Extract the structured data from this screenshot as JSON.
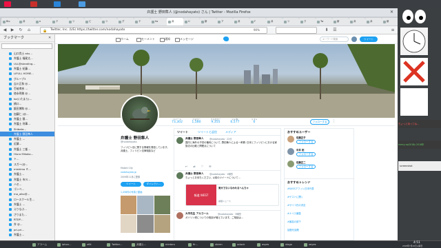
{
  "window_title": "弁護士 野田隼人 (@nodahayato) さん | Twitter - Mozilla Firefox",
  "tabs": [
    "Blo",
    "弁",
    "e",
    "テ",
    "ツ",
    "ビ",
    "ツ",
    "グ",
    "テ",
    "tw",
    "弁",
    "U",
    "新",
    "ア",
    "弁",
    "F",
    "弁",
    "ツ",
    "ク",
    "Tw",
    "新",
    "弁",
    "弁",
    "新"
  ],
  "url": "Twitter, Inc. (US)  https://twitter.com/nodahayato",
  "zoom": "90%",
  "sidebar": {
    "title": "ブックマーク",
    "items": [
      "山口貴士 aku…",
      "弁護士 福尾太…",
      "ULL@standing…",
      "弁護士 紀藤…",
      "LIFULL HOME…",
      "グループ3",
      "吉川正和 @…",
      "壱岐孝彦 …",
      "徳永明美 @…",
      "ka(いたまら)…",
      "橋口…",
      "飯田博和 @…",
      "加藤仁 (@…",
      "弁護士 猿…",
      "弁護士 刑事…",
      "Shibata…",
      "弁護士 野田隼人",
      "弁護士 …",
      "近藤…",
      "弁護士 三峯…",
      "Hiura Mikako…",
      "ト…",
      "スガー(@…",
      "mishima ミ…",
      "弁護士…",
      "弁護士 市川…",
      "ハセ…",
      "ゴンベ…",
      "mo_aiko@…",
      "ロースクール生…",
      "弁護士 …",
      "えりなぷ…",
      "さりまた…",
      "RTDP…",
      "弁 @…",
      "pri-pri…",
      "弁護士…"
    ],
    "selected_index": 16
  },
  "twitter": {
    "nav": [
      "ホーム",
      "モーメント",
      "通知",
      "メッセージ"
    ],
    "search_placeholder": "キーワード検索",
    "tweet_button": "ツイート",
    "stats": [
      {
        "label": "ツイート",
        "value": "73,302"
      },
      {
        "label": "フォロー",
        "value": "1,580"
      },
      {
        "label": "フォロワー",
        "value": "9,355"
      },
      {
        "label": "いいね",
        "value": "6,577"
      },
      {
        "label": "リスト",
        "value": "6"
      }
    ],
    "follow_button": "フォローする",
    "profile": {
      "name": "弁護士 野田隼人",
      "handle": "@nodahayato",
      "bio": "フィリピン法に関する情報を発信しています。弁護士、フィリピン法律相談など",
      "location": "Makati City",
      "website": "nodahayato.jp",
      "joined": "2009年11月に登録",
      "btn_tweet": "ツイート",
      "btn_dm": "ダイレクト…",
      "photos_label": "1,458件の写真と動画"
    },
    "timeline_tabs": [
      "ツイート",
      "ツイートと返信",
      "メディア"
    ],
    "tweets": [
      {
        "name": "弁護士 野田隼人",
        "handle": "@nodahayato · 22分",
        "text": "国内と海外の子供の権利について, 野田隼人による一考察: 日本とフィリピンにおける家族法の比較と問題点について"
      },
      {
        "name": "弁護士 野田隼人",
        "handle": "@nodahayato · 1時間",
        "text": "ちょっとお待ちください, 以前のツイートについて…"
      },
      {
        "name": "大平先生 アカコール",
        "handle": "@nodahayato · 3時間",
        "text": "ガソリン税についての相談が増えています。ご相談は…"
      }
    ],
    "card": {
      "left": "報道 WEST",
      "title": "東大でないなわれるへんちゃ",
      "desc": "産経ニュース"
    },
    "who_to_follow": {
      "title": "おすすめユーザー",
      "users": [
        {
          "name": "佐藤正子",
          "handle": "@"
        },
        {
          "name": "中井 拓",
          "handle": "@"
        },
        {
          "name": "佐藤正二",
          "handle": "@"
        }
      ],
      "follow_label": "フォローする"
    },
    "trends": {
      "title": "おすすめトレンド",
      "items": [
        "#KASSアフィレ日本代表",
        "#ゲストに聞く",
        "#サイコ氏の決定",
        "#ナイス暴露",
        "#最高の部下",
        "話題を話題"
      ]
    }
  },
  "right_panel": {
    "label1": "ちょっと待ってね…",
    "label2": "mercy-ep2018y 2018年",
    "label3": "screenshot"
  },
  "taskbar": {
    "items": [
      "アラーム",
      "iphon…",
      "x64",
      "Twitter…",
      "弁護士…",
      "mintarx",
      "fir…",
      "xterm",
      "xclock",
      "asyes",
      "xlogo",
      "xeyes"
    ],
    "clock_time": "4:51",
    "clock_date": "2018年7月10日火曜日"
  }
}
